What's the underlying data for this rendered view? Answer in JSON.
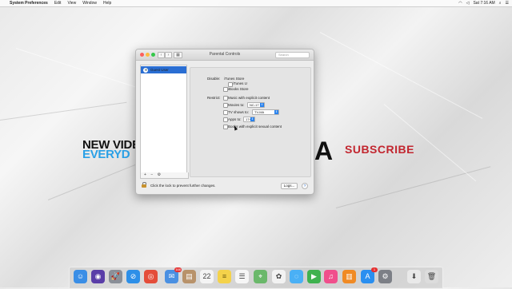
{
  "menubar": {
    "app_name": "System Preferences",
    "menus": [
      "Edit",
      "View",
      "Window",
      "Help"
    ],
    "clock": "Sat 7:16 AM"
  },
  "background": {
    "line1": "NEW VIDE",
    "line2": "EVERYD",
    "big_letter": "A",
    "subscribe": "SUBSCRIBE"
  },
  "window": {
    "title": "Parental Controls",
    "search_placeholder": "Search",
    "sidebar_user": "Guest User",
    "sidebar_controls": [
      "+",
      "−",
      "⚙"
    ],
    "tabs": [
      {
        "label": "Apps",
        "selected": false
      },
      {
        "label": "Web",
        "selected": false
      },
      {
        "label": "Stores",
        "selected": true
      },
      {
        "label": "Time",
        "selected": false
      },
      {
        "label": "Privacy",
        "selected": false
      },
      {
        "label": "Other",
        "selected": false
      }
    ],
    "disable_label": "Disable:",
    "disable_items": [
      "iTunes Store",
      "iTunes U",
      "iBooks Store"
    ],
    "restrict_label": "Restrict:",
    "restrict_music": "Music with explicit content",
    "movies_label": "Movies to:",
    "movies_value": "NC-17",
    "tv_label": "TV shows to:",
    "tv_value": "TV-MA",
    "apps_label": "Apps to:",
    "apps_value": "17+",
    "books_label": "Books with explicit sexual content",
    "lock_text": "Click the lock to prevent further changes.",
    "logs_button": "Logs...",
    "help_button": "?"
  },
  "dock": {
    "apps": [
      {
        "name": "Finder",
        "color": "#3a8ee6",
        "glyph": "☺"
      },
      {
        "name": "Siri",
        "color": "#5a3ea8",
        "glyph": "◉"
      },
      {
        "name": "Launchpad",
        "color": "#8a8f98",
        "glyph": "🚀"
      },
      {
        "name": "Safari",
        "color": "#2d8fe8",
        "glyph": "⊘"
      },
      {
        "name": "Chrome",
        "color": "#e44d3a",
        "glyph": "◎"
      },
      {
        "name": "Mail",
        "color": "#4a90e2",
        "glyph": "✉",
        "badge": "166"
      },
      {
        "name": "Contacts",
        "color": "#b8926a",
        "glyph": "▤"
      },
      {
        "name": "Calendar",
        "color": "#f4f4f4",
        "glyph": "22"
      },
      {
        "name": "Notes",
        "color": "#f4d24a",
        "glyph": "≡"
      },
      {
        "name": "Reminders",
        "color": "#f6f6f6",
        "glyph": "☰"
      },
      {
        "name": "Maps",
        "color": "#6ab86a",
        "glyph": "⌖"
      },
      {
        "name": "Photos",
        "color": "#f2f2f2",
        "glyph": "✿"
      },
      {
        "name": "Messages",
        "color": "#4ab0f5",
        "glyph": "◌"
      },
      {
        "name": "FaceTime",
        "color": "#3fb24f",
        "glyph": "▶"
      },
      {
        "name": "iTunes",
        "color": "#f04f8c",
        "glyph": "♫"
      },
      {
        "name": "iBooks",
        "color": "#f08a24",
        "glyph": "▥"
      },
      {
        "name": "App Store",
        "color": "#2a8ff0",
        "glyph": "A",
        "badge": "1"
      },
      {
        "name": "System Preferences",
        "color": "#7c7f86",
        "glyph": "⚙"
      },
      {
        "name": "Downloads",
        "color": "#e9e9e9",
        "glyph": "⬇"
      },
      {
        "name": "Trash",
        "color": "#dcdcdc",
        "glyph": "🗑"
      }
    ]
  }
}
